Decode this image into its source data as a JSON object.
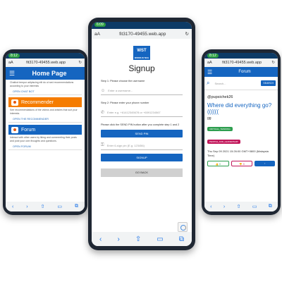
{
  "left_phone": {
    "status_time": "8:12",
    "url": "fit3170-49455.web.app",
    "header_title": "Home Page",
    "intro_text": "Chatbot tempor adipiscing elit do ut sed recommendations according to your interests",
    "chat_link": "OPEN CHAT BOT",
    "recommender": {
      "title": "Recommender",
      "desc": "See recommendations of the videos and articles that suit your interests.",
      "link": "OPEN THE RECOMMENDER"
    },
    "forum": {
      "title": "Forum",
      "desc": "Interact with other users by liking and commenting their posts and post your own thoughts and questions.",
      "link": "OPEN FORUM"
    }
  },
  "middle_phone": {
    "status_time": "6:09",
    "url": "fit3170-49455.web.app",
    "logo_text": "WST",
    "logo_sub": "WORDS IN TECH",
    "title": "Signup",
    "step1": "Step 1: Please choose the username",
    "username_placeholder": "Enter a username...",
    "step2": "Step 2: Please enter your phone number",
    "phone_placeholder": "Enter e.g. +61412345678 or +6591234567",
    "step3": "Please click the SEND PIN button after you complete step 1 and 2",
    "send_pin": "SEND PIN",
    "pin_placeholder": "Enter 6-sign pin (E.g. 123456)",
    "signup": "SIGNUP",
    "go_back": "GO BACK"
  },
  "right_phone": {
    "status_time": "8:12",
    "url": "fit3170-49455.web.app",
    "header_title": "Forum",
    "search_placeholder": "Search...",
    "search_button": "SEARCH",
    "username": "@pupsichek26",
    "post_title": "Where did everything go?((((((",
    "post_body": "gg",
    "tags": [
      "CRITICAL_THINKING",
      "PEOPLE_AND_LEADERSHIP"
    ],
    "date": "Thu Sep 09 2021 15:26:00 GMT+0800 (Malaysia Time)",
    "likes": "0",
    "dislikes": "0"
  }
}
